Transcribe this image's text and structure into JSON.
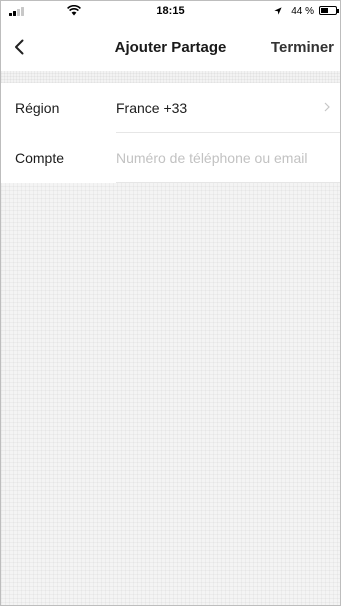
{
  "status_bar": {
    "time": "18:15",
    "battery": "44 %",
    "signal_bars": 2,
    "icons": [
      "cellular-signal-icon",
      "wifi-icon",
      "location-arrow-icon",
      "battery-icon"
    ]
  },
  "nav": {
    "title": "Ajouter Partage",
    "done_label": "Terminer",
    "back_icon": "chevron-left-icon"
  },
  "form": {
    "region": {
      "label": "Région",
      "value": "France +33",
      "icon": "chevron-right-icon"
    },
    "account": {
      "label": "Compte",
      "value": "",
      "placeholder": "Numéro de téléphone ou email"
    }
  },
  "colors": {
    "background": "#f2f2f2",
    "surface": "#ffffff",
    "text": "#1c1c1c",
    "placeholder": "#c2c2c2",
    "divider": "#e6e6e6"
  }
}
